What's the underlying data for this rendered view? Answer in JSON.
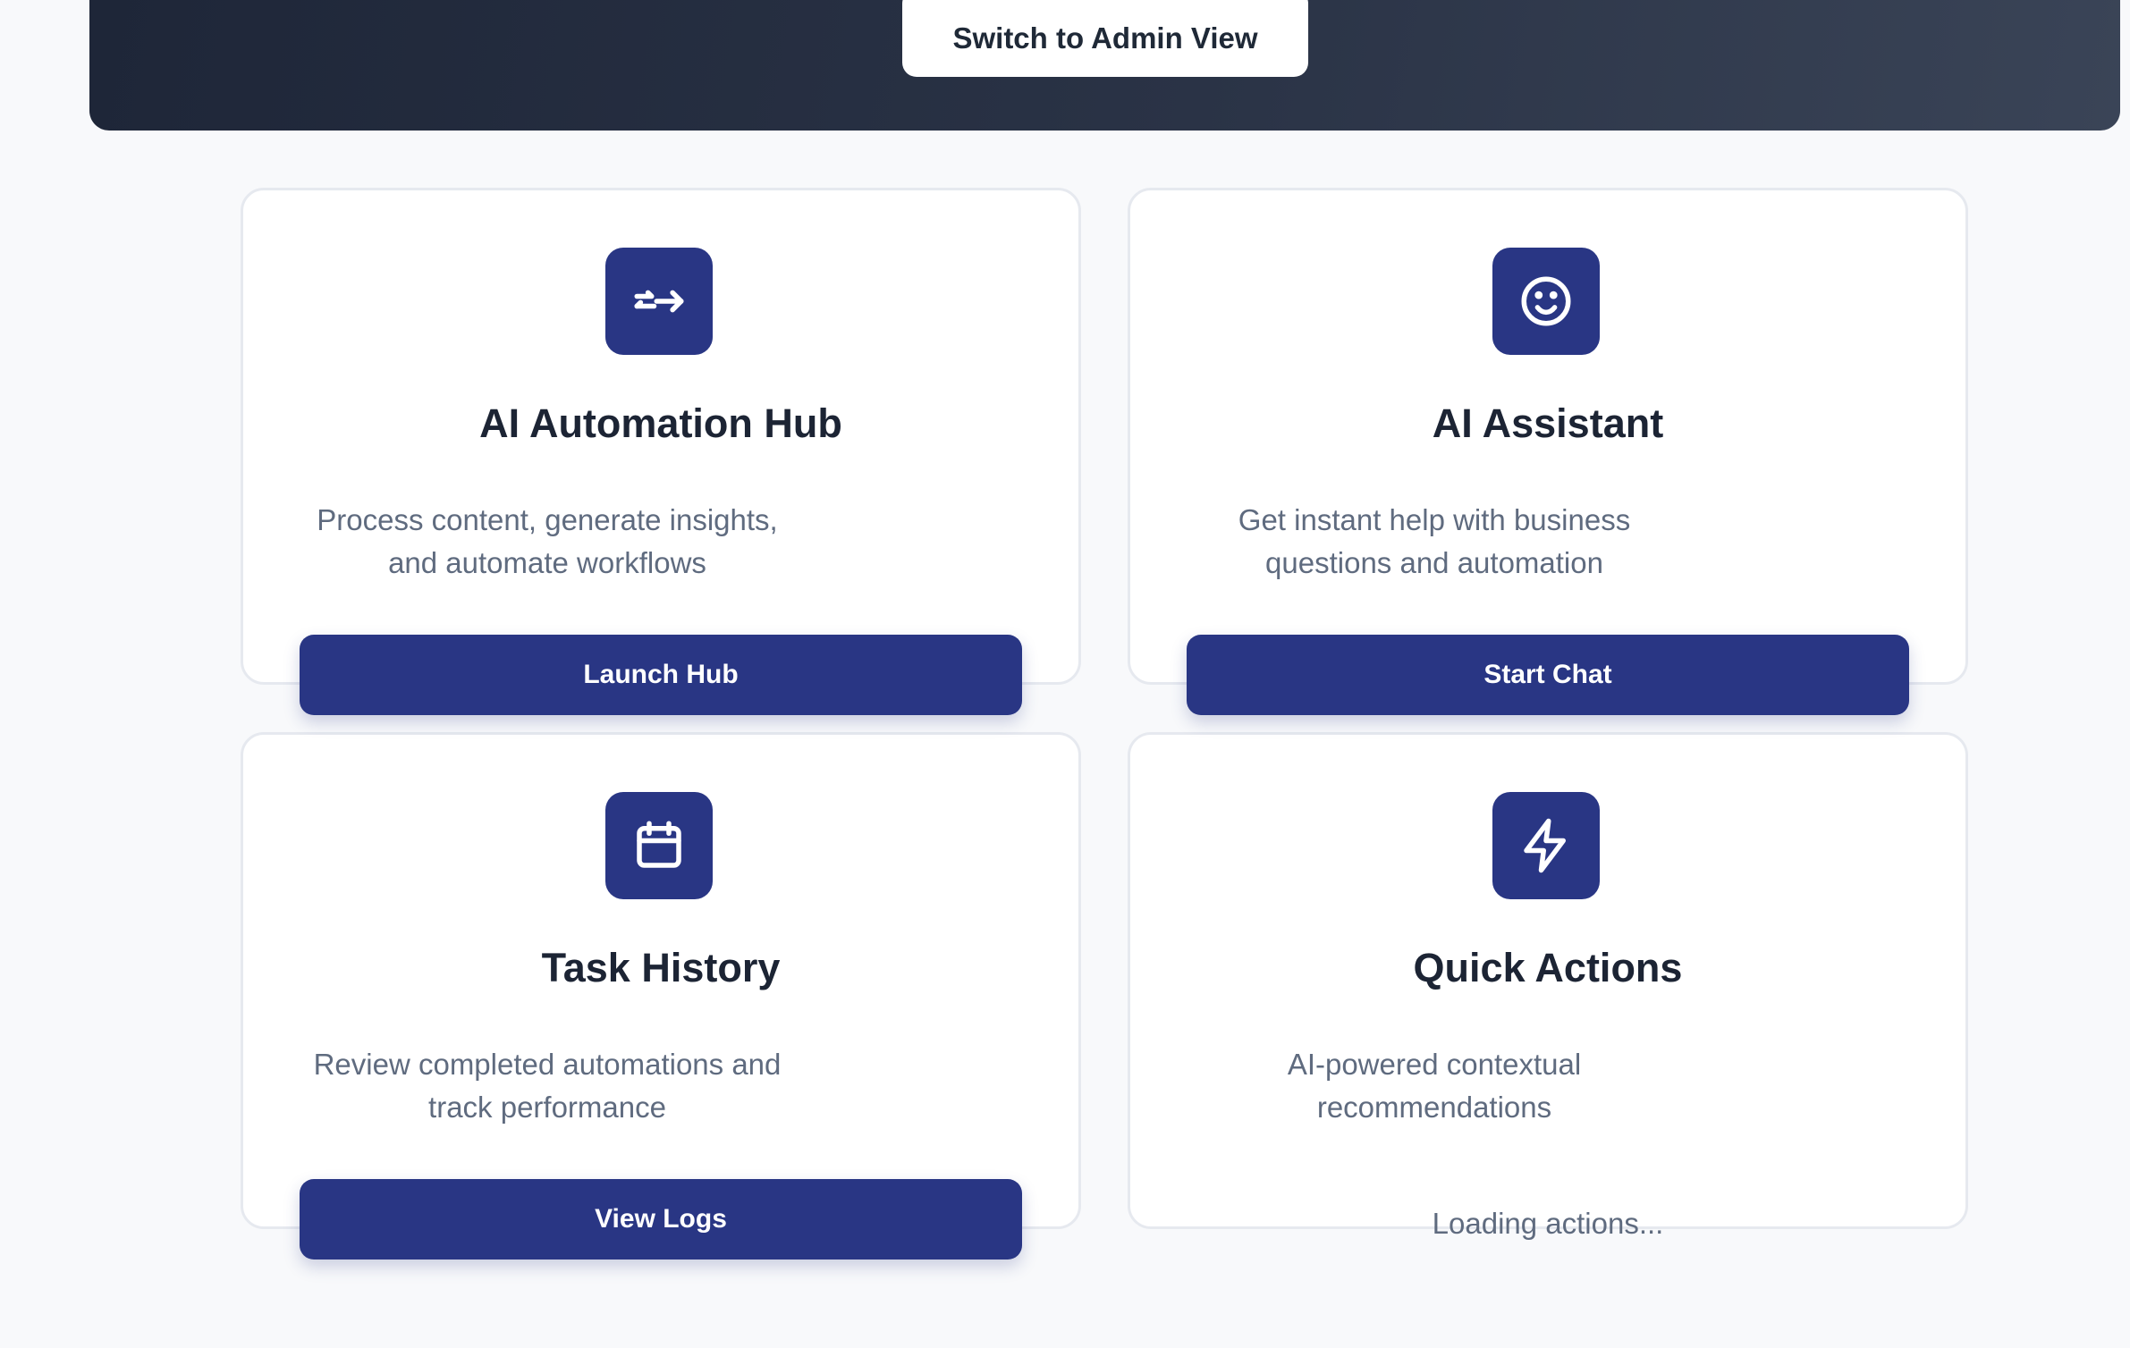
{
  "header": {
    "admin_button_label": "Switch to Admin View"
  },
  "cards": [
    {
      "icon": "route-arrow-icon",
      "title": "AI Automation Hub",
      "description": "Process content, generate insights, and automate workflows",
      "button_label": "Launch Hub"
    },
    {
      "icon": "smiley-icon",
      "title": "AI Assistant",
      "description": "Get instant help with business questions and automation",
      "button_label": "Start Chat"
    },
    {
      "icon": "calendar-icon",
      "title": "Task History",
      "description": "Review completed automations and track performance",
      "button_label": "View Logs"
    },
    {
      "icon": "lightning-icon",
      "title": "Quick Actions",
      "description": "AI-powered contextual recommendations",
      "status_text": "Loading actions..."
    }
  ],
  "colors": {
    "accent": "#293684",
    "hero_dark": "#1e2638",
    "page_background": "#f8f9fb"
  }
}
